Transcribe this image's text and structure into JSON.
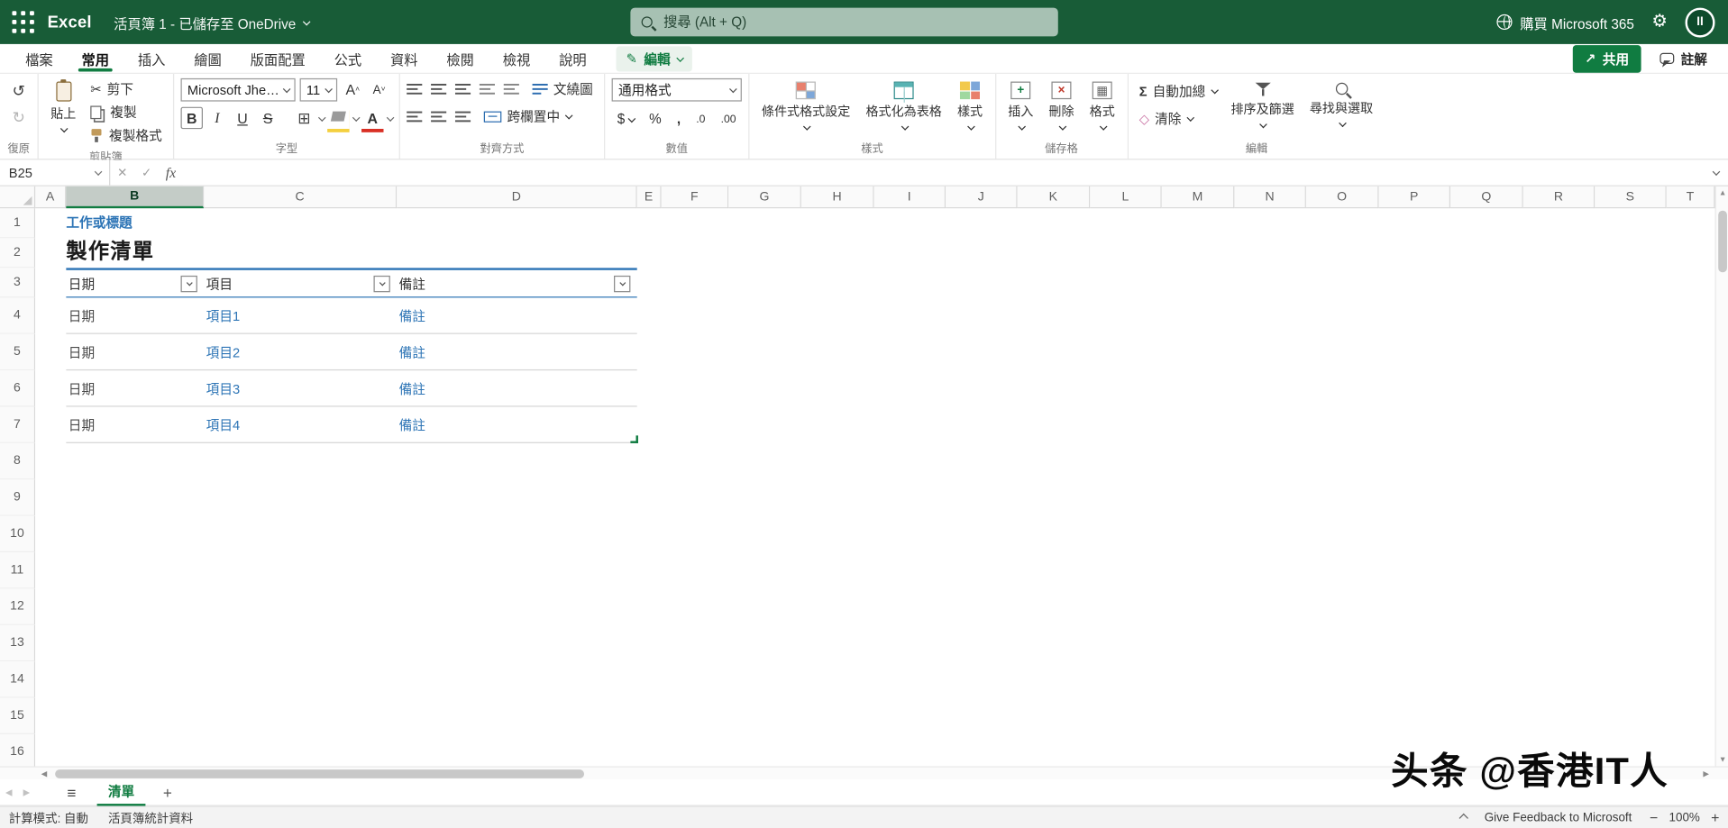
{
  "topbar": {
    "app_name": "Excel",
    "workbook_title": "活頁簿 1 - 已儲存至 OneDrive",
    "search_placeholder": "搜尋 (Alt + Q)",
    "buy_label": "購買 Microsoft 365",
    "avatar_initials": "II"
  },
  "menubar": {
    "tabs": [
      "檔案",
      "常用",
      "插入",
      "繪圖",
      "版面配置",
      "公式",
      "資料",
      "檢閱",
      "檢視",
      "說明"
    ],
    "active_tab": "常用",
    "edit_label": "編輯",
    "share_label": "共用",
    "comments_label": "註解"
  },
  "ribbon": {
    "undo": {
      "label": "復原"
    },
    "clipboard": {
      "paste": "貼上",
      "cut": "剪下",
      "copy": "複製",
      "format_painter": "複製格式",
      "label": "剪貼簿"
    },
    "font": {
      "font_name": "Microsoft JhengHe...",
      "font_size": "11",
      "bold": "B",
      "italic": "I",
      "underline": "U",
      "strike": "S",
      "color_letter": "A",
      "grow": "A",
      "shrink": "A",
      "label": "字型"
    },
    "alignment": {
      "wrap_text": "文繞圖",
      "merge_center": "跨欄置中",
      "label": "對齊方式"
    },
    "number": {
      "format": "通用格式",
      "dollar": "$",
      "percent": "%",
      "comma": ",",
      "dec_dec": ".0",
      "dec_inc": ".00",
      "label": "數值"
    },
    "styles": {
      "conditional": "條件式格式設定",
      "format_table": "格式化為表格",
      "cell_styles": "樣式",
      "label": "樣式"
    },
    "cells": {
      "insert": "插入",
      "delete": "刪除",
      "format": "格式",
      "label": "儲存格"
    },
    "editing": {
      "autosum": "自動加總",
      "clear": "清除",
      "sort_filter": "排序及篩選",
      "find_select": "尋找與選取",
      "label": "編輯"
    }
  },
  "formula_bar": {
    "name_box": "B25",
    "fx_label": "fx"
  },
  "grid": {
    "columns": [
      "A",
      "B",
      "C",
      "D",
      "E",
      "F",
      "G",
      "H",
      "I",
      "J",
      "K",
      "L",
      "M",
      "N",
      "O",
      "P",
      "Q",
      "R",
      "S",
      "T"
    ],
    "selected_column": "B",
    "rows": [
      "1",
      "2",
      "3",
      "4",
      "5",
      "6",
      "7",
      "8",
      "9",
      "10",
      "11",
      "12",
      "13",
      "14",
      "15",
      "16"
    ],
    "cells": {
      "b1_title": "工作或標題",
      "b2_heading": "製作清單"
    },
    "table": {
      "headers": [
        "日期",
        "項目",
        "備註"
      ],
      "rows": [
        [
          "日期",
          "項目1",
          "備註"
        ],
        [
          "日期",
          "項目2",
          "備註"
        ],
        [
          "日期",
          "項目3",
          "備註"
        ],
        [
          "日期",
          "項目4",
          "備註"
        ]
      ]
    }
  },
  "sheet_bar": {
    "sheet_name": "清單",
    "add_label": "+"
  },
  "status_bar": {
    "calc_mode": "計算模式: 自動",
    "workbook_stats": "活頁簿統計資料",
    "feedback": "Give Feedback to Microsoft",
    "zoom_out": "−",
    "zoom_level": "100%",
    "zoom_in": "+"
  },
  "watermark": "头条 @香港IT人",
  "icons": {
    "gear": "⚙",
    "undo": "↺",
    "redo": "↻",
    "cut": "✂",
    "sum": "Σ",
    "clear": "◇",
    "pencil": "✎",
    "share_arrow": "↗",
    "hamburger": "≡",
    "close": "✕",
    "check": "✓",
    "borders": "⊞",
    "left_arrow": "◀",
    "right_arrow": "▶",
    "up_arrow": "▲",
    "down_arrow": "▼"
  },
  "colors": {
    "header_green": "#185C37",
    "accent_green": "#107C41",
    "link_blue": "#2E75B6"
  }
}
